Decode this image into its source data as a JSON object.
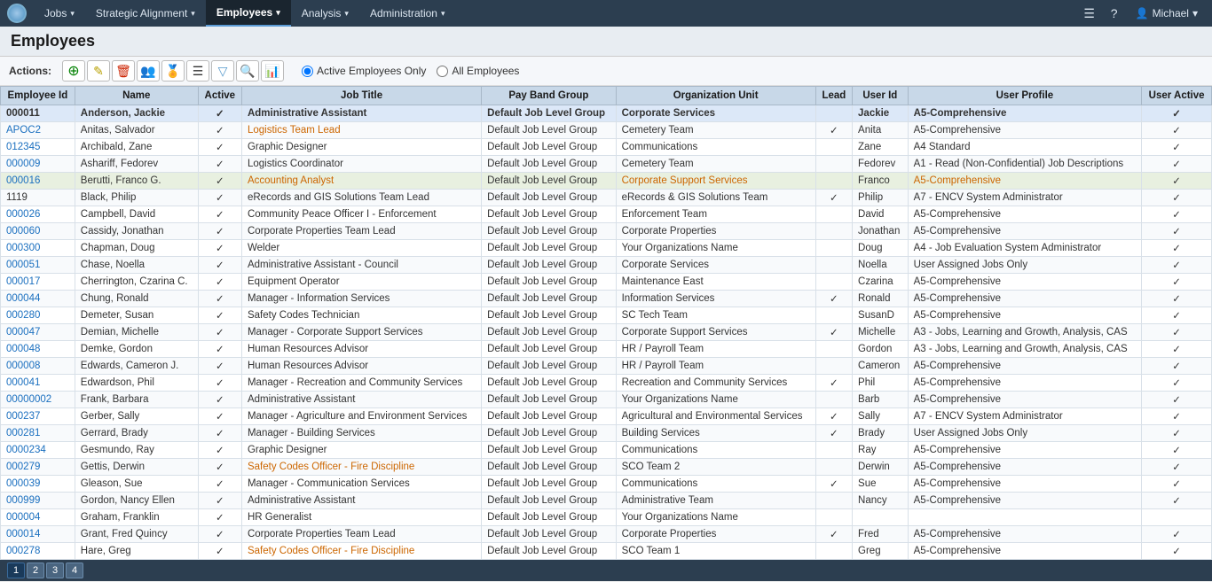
{
  "nav": {
    "logo": "logo",
    "items": [
      {
        "label": "Jobs",
        "arrow": "▾",
        "active": false
      },
      {
        "label": "Strategic Alignment",
        "arrow": "▾",
        "active": false
      },
      {
        "label": "Employees",
        "arrow": "▾",
        "active": true
      },
      {
        "label": "Analysis",
        "arrow": "▾",
        "active": false
      },
      {
        "label": "Administration",
        "arrow": "▾",
        "active": false
      }
    ],
    "user": "Michael",
    "user_arrow": "▾"
  },
  "page": {
    "title": "Employees"
  },
  "actions": {
    "label": "Actions:",
    "radio_active": "Active Employees Only",
    "radio_all": "All Employees"
  },
  "table": {
    "headers": [
      "Employee Id",
      "Name",
      "Active",
      "Job Title",
      "Pay Band Group",
      "Organization Unit",
      "Lead",
      "User Id",
      "User Profile",
      "User Active"
    ],
    "rows": [
      {
        "id": "000011",
        "name": "Anderson, Jackie",
        "active": "✓",
        "job_title": "Administrative Assistant",
        "pay_band": "Default Job Level Group",
        "org_unit": "Corporate Services",
        "lead": "",
        "user_id": "Jackie",
        "profile": "A5-Comprehensive",
        "user_active": "✓",
        "row_class": "selected",
        "id_class": "text-bold",
        "name_class": "text-bold",
        "job_class": "text-bold",
        "org_class": "text-bold",
        "profile_class": "text-bold"
      },
      {
        "id": "APOC2",
        "name": "Anitas, Salvador",
        "active": "✓",
        "job_title": "Logistics Team Lead",
        "pay_band": "Default Job Level Group",
        "org_unit": "Cemetery Team",
        "lead": "✓",
        "user_id": "Anita",
        "profile": "A5-Comprehensive",
        "user_active": "✓",
        "row_class": "",
        "id_class": "text-blue",
        "name_class": "",
        "job_class": "text-orange",
        "org_class": "",
        "profile_class": ""
      },
      {
        "id": "012345",
        "name": "Archibald, Zane",
        "active": "✓",
        "job_title": "Graphic Designer",
        "pay_band": "Default Job Level Group",
        "org_unit": "Communications",
        "lead": "",
        "user_id": "Zane",
        "profile": "A4 Standard",
        "user_active": "✓",
        "row_class": "",
        "id_class": "text-blue",
        "name_class": "",
        "job_class": "",
        "org_class": "",
        "profile_class": ""
      },
      {
        "id": "000009",
        "name": "Ashariff, Fedorev",
        "active": "✓",
        "job_title": "Logistics Coordinator",
        "pay_band": "Default Job Level Group",
        "org_unit": "Cemetery Team",
        "lead": "",
        "user_id": "Fedorev",
        "profile": "A1 - Read (Non-Confidential) Job Descriptions",
        "user_active": "✓",
        "row_class": "",
        "id_class": "text-blue",
        "name_class": "",
        "job_class": "",
        "org_class": "",
        "profile_class": ""
      },
      {
        "id": "000016",
        "name": "Berutti, Franco G.",
        "active": "✓",
        "job_title": "Accounting Analyst",
        "pay_band": "Default Job Level Group",
        "org_unit": "Corporate Support Services",
        "lead": "",
        "user_id": "Franco",
        "profile": "A5-Comprehensive",
        "user_active": "✓",
        "row_class": "highlighted",
        "id_class": "text-blue",
        "name_class": "",
        "job_class": "text-orange",
        "org_class": "text-orange",
        "profile_class": "text-orange"
      },
      {
        "id": "1119",
        "name": "Black, Philip",
        "active": "✓",
        "job_title": "eRecords and GIS Solutions Team Lead",
        "pay_band": "Default Job Level Group",
        "org_unit": "eRecords & GIS Solutions Team",
        "lead": "✓",
        "user_id": "Philip",
        "profile": "A7 - ENCV System Administrator",
        "user_active": "✓",
        "row_class": "",
        "id_class": "",
        "name_class": "",
        "job_class": "",
        "org_class": "",
        "profile_class": ""
      },
      {
        "id": "000026",
        "name": "Campbell, David",
        "active": "✓",
        "job_title": "Community Peace Officer I - Enforcement",
        "pay_band": "Default Job Level Group",
        "org_unit": "Enforcement Team",
        "lead": "",
        "user_id": "David",
        "profile": "A5-Comprehensive",
        "user_active": "✓",
        "row_class": "",
        "id_class": "text-blue",
        "name_class": "",
        "job_class": "",
        "org_class": "",
        "profile_class": ""
      },
      {
        "id": "000060",
        "name": "Cassidy, Jonathan",
        "active": "✓",
        "job_title": "Corporate Properties Team Lead",
        "pay_band": "Default Job Level Group",
        "org_unit": "Corporate Properties",
        "lead": "",
        "user_id": "Jonathan",
        "profile": "A5-Comprehensive",
        "user_active": "✓",
        "row_class": "",
        "id_class": "text-blue",
        "name_class": "",
        "job_class": "",
        "org_class": "",
        "profile_class": ""
      },
      {
        "id": "000300",
        "name": "Chapman, Doug",
        "active": "✓",
        "job_title": "Welder",
        "pay_band": "Default Job Level Group",
        "org_unit": "Your Organizations Name",
        "lead": "",
        "user_id": "Doug",
        "profile": "A4 - Job Evaluation System Administrator",
        "user_active": "✓",
        "row_class": "",
        "id_class": "text-blue",
        "name_class": "",
        "job_class": "",
        "org_class": "",
        "profile_class": ""
      },
      {
        "id": "000051",
        "name": "Chase, Noella",
        "active": "✓",
        "job_title": "Administrative Assistant - Council",
        "pay_band": "Default Job Level Group",
        "org_unit": "Corporate Services",
        "lead": "",
        "user_id": "Noella",
        "profile": "User Assigned Jobs Only",
        "user_active": "✓",
        "row_class": "",
        "id_class": "text-blue",
        "name_class": "",
        "job_class": "",
        "org_class": "",
        "profile_class": ""
      },
      {
        "id": "000017",
        "name": "Cherrington, Czarina C.",
        "active": "✓",
        "job_title": "Equipment Operator",
        "pay_band": "Default Job Level Group",
        "org_unit": "Maintenance East",
        "lead": "",
        "user_id": "Czarina",
        "profile": "A5-Comprehensive",
        "user_active": "✓",
        "row_class": "",
        "id_class": "text-blue",
        "name_class": "",
        "job_class": "",
        "org_class": "",
        "profile_class": ""
      },
      {
        "id": "000044",
        "name": "Chung, Ronald",
        "active": "✓",
        "job_title": "Manager - Information Services",
        "pay_band": "Default Job Level Group",
        "org_unit": "Information Services",
        "lead": "✓",
        "user_id": "Ronald",
        "profile": "A5-Comprehensive",
        "user_active": "✓",
        "row_class": "",
        "id_class": "text-blue",
        "name_class": "",
        "job_class": "",
        "org_class": "",
        "profile_class": ""
      },
      {
        "id": "000280",
        "name": "Demeter, Susan",
        "active": "✓",
        "job_title": "Safety Codes Technician",
        "pay_band": "Default Job Level Group",
        "org_unit": "SC Tech Team",
        "lead": "",
        "user_id": "SusanD",
        "profile": "A5-Comprehensive",
        "user_active": "✓",
        "row_class": "",
        "id_class": "text-blue",
        "name_class": "",
        "job_class": "",
        "org_class": "",
        "profile_class": ""
      },
      {
        "id": "000047",
        "name": "Demian, Michelle",
        "active": "✓",
        "job_title": "Manager - Corporate Support Services",
        "pay_band": "Default Job Level Group",
        "org_unit": "Corporate Support Services",
        "lead": "✓",
        "user_id": "Michelle",
        "profile": "A3 - Jobs, Learning and Growth, Analysis, CAS",
        "user_active": "✓",
        "row_class": "",
        "id_class": "text-blue",
        "name_class": "",
        "job_class": "",
        "org_class": "",
        "profile_class": ""
      },
      {
        "id": "000048",
        "name": "Demke, Gordon",
        "active": "✓",
        "job_title": "Human Resources Advisor",
        "pay_band": "Default Job Level Group",
        "org_unit": "HR / Payroll Team",
        "lead": "",
        "user_id": "Gordon",
        "profile": "A3 - Jobs, Learning and Growth, Analysis, CAS",
        "user_active": "✓",
        "row_class": "",
        "id_class": "text-blue",
        "name_class": "",
        "job_class": "",
        "org_class": "",
        "profile_class": ""
      },
      {
        "id": "000008",
        "name": "Edwards, Cameron J.",
        "active": "✓",
        "job_title": "Human Resources Advisor",
        "pay_band": "Default Job Level Group",
        "org_unit": "HR / Payroll Team",
        "lead": "",
        "user_id": "Cameron",
        "profile": "A5-Comprehensive",
        "user_active": "✓",
        "row_class": "",
        "id_class": "text-blue",
        "name_class": "",
        "job_class": "",
        "org_class": "",
        "profile_class": ""
      },
      {
        "id": "000041",
        "name": "Edwardson, Phil",
        "active": "✓",
        "job_title": "Manager - Recreation and Community Services",
        "pay_band": "Default Job Level Group",
        "org_unit": "Recreation and Community Services",
        "lead": "✓",
        "user_id": "Phil",
        "profile": "A5-Comprehensive",
        "user_active": "✓",
        "row_class": "",
        "id_class": "text-blue",
        "name_class": "",
        "job_class": "",
        "org_class": "",
        "profile_class": ""
      },
      {
        "id": "00000002",
        "name": "Frank, Barbara",
        "active": "✓",
        "job_title": "Administrative Assistant",
        "pay_band": "Default Job Level Group",
        "org_unit": "Your Organizations Name",
        "lead": "",
        "user_id": "Barb",
        "profile": "A5-Comprehensive",
        "user_active": "✓",
        "row_class": "",
        "id_class": "text-blue",
        "name_class": "",
        "job_class": "",
        "org_class": "",
        "profile_class": ""
      },
      {
        "id": "000237",
        "name": "Gerber, Sally",
        "active": "✓",
        "job_title": "Manager - Agriculture and Environment Services",
        "pay_band": "Default Job Level Group",
        "org_unit": "Agricultural and Environmental Services",
        "lead": "✓",
        "user_id": "Sally",
        "profile": "A7 - ENCV System Administrator",
        "user_active": "✓",
        "row_class": "",
        "id_class": "text-blue",
        "name_class": "",
        "job_class": "",
        "org_class": "",
        "profile_class": ""
      },
      {
        "id": "000281",
        "name": "Gerrard, Brady",
        "active": "✓",
        "job_title": "Manager - Building Services",
        "pay_band": "Default Job Level Group",
        "org_unit": "Building Services",
        "lead": "✓",
        "user_id": "Brady",
        "profile": "User Assigned Jobs Only",
        "user_active": "✓",
        "row_class": "",
        "id_class": "text-blue",
        "name_class": "",
        "job_class": "",
        "org_class": "",
        "profile_class": ""
      },
      {
        "id": "0000234",
        "name": "Gesmundo, Ray",
        "active": "✓",
        "job_title": "Graphic Designer",
        "pay_band": "Default Job Level Group",
        "org_unit": "Communications",
        "lead": "",
        "user_id": "Ray",
        "profile": "A5-Comprehensive",
        "user_active": "✓",
        "row_class": "",
        "id_class": "text-blue",
        "name_class": "",
        "job_class": "",
        "org_class": "",
        "profile_class": ""
      },
      {
        "id": "000279",
        "name": "Gettis, Derwin",
        "active": "✓",
        "job_title": "Safety Codes Officer - Fire Discipline",
        "pay_band": "Default Job Level Group",
        "org_unit": "SCO Team 2",
        "lead": "",
        "user_id": "Derwin",
        "profile": "A5-Comprehensive",
        "user_active": "✓",
        "row_class": "",
        "id_class": "text-blue",
        "name_class": "",
        "job_class": "text-orange",
        "org_class": "",
        "profile_class": ""
      },
      {
        "id": "000039",
        "name": "Gleason, Sue",
        "active": "✓",
        "job_title": "Manager - Communication Services",
        "pay_band": "Default Job Level Group",
        "org_unit": "Communications",
        "lead": "✓",
        "user_id": "Sue",
        "profile": "A5-Comprehensive",
        "user_active": "✓",
        "row_class": "",
        "id_class": "text-blue",
        "name_class": "",
        "job_class": "",
        "org_class": "",
        "profile_class": ""
      },
      {
        "id": "000999",
        "name": "Gordon, Nancy Ellen",
        "active": "✓",
        "job_title": "Administrative Assistant",
        "pay_band": "Default Job Level Group",
        "org_unit": "Administrative Team",
        "lead": "",
        "user_id": "Nancy",
        "profile": "A5-Comprehensive",
        "user_active": "✓",
        "row_class": "",
        "id_class": "text-blue",
        "name_class": "",
        "job_class": "",
        "org_class": "",
        "profile_class": ""
      },
      {
        "id": "000004",
        "name": "Graham, Franklin",
        "active": "✓",
        "job_title": "HR Generalist",
        "pay_band": "Default Job Level Group",
        "org_unit": "Your Organizations Name",
        "lead": "",
        "user_id": "",
        "profile": "",
        "user_active": "",
        "row_class": "",
        "id_class": "text-blue",
        "name_class": "",
        "job_class": "",
        "org_class": "",
        "profile_class": ""
      },
      {
        "id": "000014",
        "name": "Grant, Fred Quincy",
        "active": "✓",
        "job_title": "Corporate Properties Team Lead",
        "pay_band": "Default Job Level Group",
        "org_unit": "Corporate Properties",
        "lead": "✓",
        "user_id": "Fred",
        "profile": "A5-Comprehensive",
        "user_active": "✓",
        "row_class": "",
        "id_class": "text-blue",
        "name_class": "",
        "job_class": "",
        "org_class": "",
        "profile_class": ""
      },
      {
        "id": "000278",
        "name": "Hare, Greg",
        "active": "✓",
        "job_title": "Safety Codes Officer - Fire Discipline",
        "pay_band": "Default Job Level Group",
        "org_unit": "SCO Team 1",
        "lead": "",
        "user_id": "Greg",
        "profile": "A5-Comprehensive",
        "user_active": "✓",
        "row_class": "",
        "id_class": "text-blue",
        "name_class": "",
        "job_class": "text-orange",
        "org_class": "",
        "profile_class": ""
      }
    ]
  },
  "pagination": {
    "pages": [
      "1",
      "2",
      "3",
      "4"
    ],
    "active_page": "1"
  }
}
